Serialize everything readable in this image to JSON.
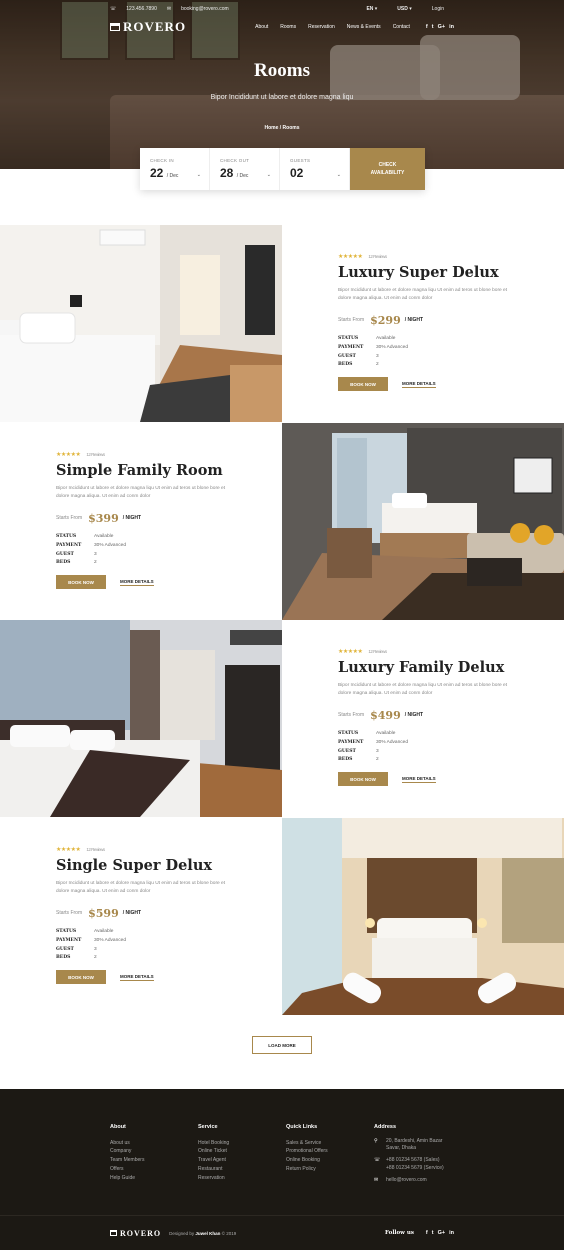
{
  "topbar": {
    "phone": "123.456.7890",
    "email": "booking@rovero.com",
    "language": "EN",
    "currency": "USD",
    "login": "Login"
  },
  "brand": {
    "name": "ROVERO"
  },
  "nav": [
    "About",
    "Rooms",
    "Reservation",
    "News & Events",
    "Contact"
  ],
  "social": [
    "f",
    "t",
    "G+",
    "in"
  ],
  "hero": {
    "title": "Rooms",
    "subtitle": "Bipor Incididunt ut labore et dolore magna liqu",
    "breadcrumb": "Home / Rooms"
  },
  "booking": {
    "check_in": {
      "label": "CHECK IN",
      "day": "22",
      "month": "/ Dec"
    },
    "check_out": {
      "label": "CHECK OUT",
      "day": "28",
      "month": "/ Dec"
    },
    "guests": {
      "label": "GUESTS",
      "value": "02"
    },
    "button": "CHECK AVAILABILITY"
  },
  "rooms": [
    {
      "name": "Luxury Super Delux",
      "reviews": "12 Reviews",
      "desc": "Bipor Incididunt ut labore et dolore magna liqu Ut enim ad teros ut blone bore et dolore magna aliqua. Ut enim ad conm dolor",
      "starts_from": "Starts From",
      "price": "$299",
      "per": "/ NIGHT",
      "status": "Available",
      "payment": "30% Advanced",
      "guest": "3",
      "beds": "2"
    },
    {
      "name": "Simple Family Room",
      "reviews": "12 Reviews",
      "desc": "Bipor Incididunt ut labore et dolore magna liqu Ut enim ad teros ut blone bore et dolore magna aliqua. Ut enim ad conm dolor",
      "starts_from": "Starts From",
      "price": "$399",
      "per": "/ NIGHT",
      "status": "Available",
      "payment": "30% Advanced",
      "guest": "3",
      "beds": "2"
    },
    {
      "name": "Luxury Family Delux",
      "reviews": "12 Reviews",
      "desc": "Bipor Incididunt ut labore et dolore magna liqu Ut enim ad teros ut blone bore et dolore magna aliqua. Ut enim ad conm dolor",
      "starts_from": "Starts From",
      "price": "$499",
      "per": "/ NIGHT",
      "status": "Available",
      "payment": "30% Advanced",
      "guest": "3",
      "beds": "2"
    },
    {
      "name": "Single Super Delux",
      "reviews": "12 Reviews",
      "desc": "Bipor Incididunt ut labore et dolore magna liqu Ut enim ad teros ut blone bore et dolore magna aliqua. Ut enim ad conm dolor",
      "starts_from": "Starts From",
      "price": "$599",
      "per": "/ NIGHT",
      "status": "Available",
      "payment": "30% Advanced",
      "guest": "3",
      "beds": "2"
    }
  ],
  "spec_labels": {
    "status": "STATUS",
    "payment": "PAYMENT",
    "guest": "GUEST",
    "beds": "BEDS"
  },
  "actions": {
    "book": "BOOK NOW",
    "details": "MORE DETAILS",
    "load_more": "LOAD MORE"
  },
  "footer": {
    "about": {
      "title": "About",
      "items": [
        "About us",
        "Company",
        "Team Members",
        "Offers",
        "Help Guide"
      ]
    },
    "service": {
      "title": "Service",
      "items": [
        "Hotel Booking",
        "Online Ticket",
        "Travel Agent",
        "Restaurant",
        "Reservation"
      ]
    },
    "links": {
      "title": "Quick Links",
      "items": [
        "Sales & Service",
        "Promotional Offers",
        "Online Booking",
        "Return Policy"
      ]
    },
    "address": {
      "title": "Address",
      "line1": "20, Bardeshi, Amin Bazar",
      "line2": "Savar, Dhaka",
      "phone1": "+88 01234 5678  (Sales)",
      "phone2": "+88 01234 5679  (Service)",
      "email": "hello@rovero.com"
    },
    "designed_by": "Designed by",
    "designer": "Juwel Khan",
    "year": "© 2019",
    "follow": "Follow us"
  },
  "colors": {
    "accent": "#a8884c",
    "footer_bg": "#1c1914",
    "stars": "#e0b43a"
  }
}
